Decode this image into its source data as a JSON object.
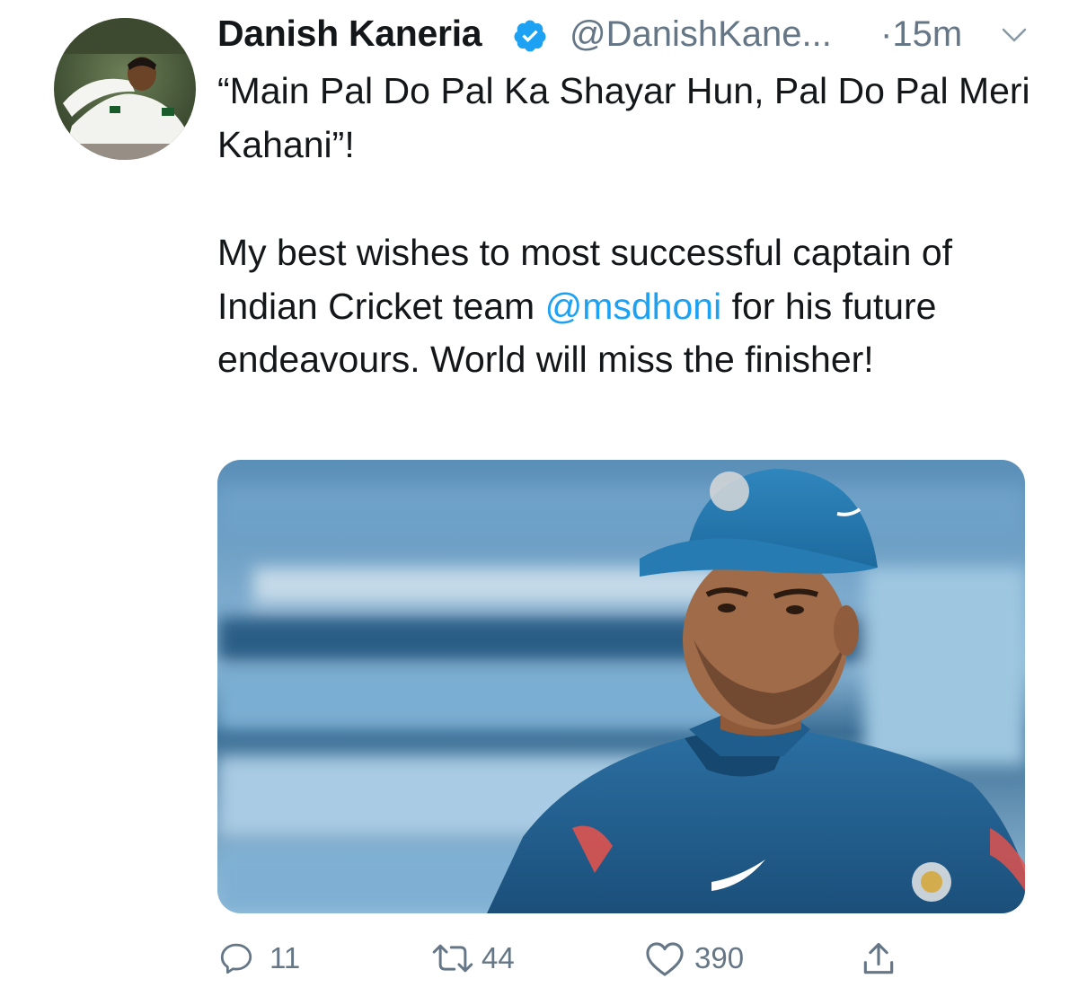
{
  "tweet": {
    "author_name": "Danish Kaneria",
    "author_handle": "@DanishKane...",
    "time": "·15m",
    "verified": true,
    "text_line1": "“Main Pal Do Pal Ka Shayar Hun, Pal Do Pal Meri Kahani”!",
    "text_part2_before": "My best wishes to most successful captain of Indian Cricket team ",
    "mention": "@msdhoni",
    "text_part2_after": " for his future endeavours. World will miss the finisher!",
    "media_description": "photo"
  },
  "actions": {
    "reply_count": "11",
    "retweet_count": "44",
    "like_count": "390"
  },
  "icons": {
    "verified": "verified-badge-icon",
    "caret": "chevron-down-icon",
    "reply": "reply-icon",
    "retweet": "retweet-icon",
    "like": "heart-icon",
    "share": "share-icon"
  },
  "colors": {
    "accent": "#1da1f2",
    "text": "#14171a",
    "secondary": "#657786"
  }
}
